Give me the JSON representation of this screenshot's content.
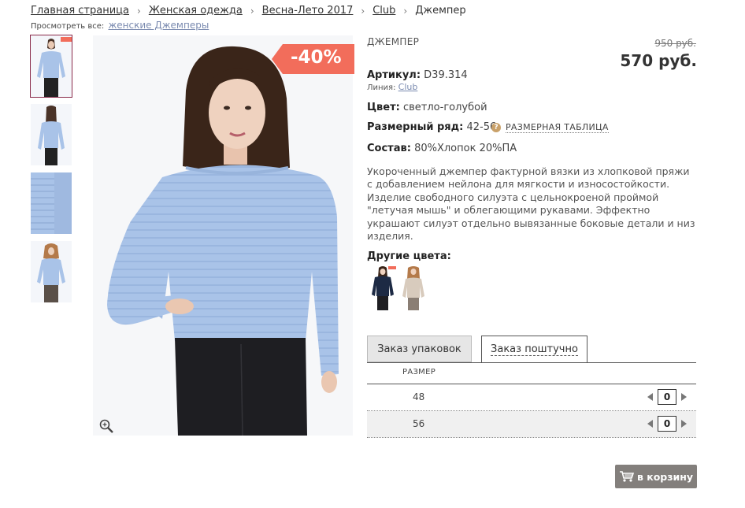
{
  "breadcrumb": {
    "items": [
      "Главная страница",
      "Женская одежда",
      "Весна-Лето 2017",
      "Club"
    ],
    "current": "Джемпер",
    "separator": "›"
  },
  "view_all": {
    "label": "Просмотреть все:",
    "link": "женские Джемперы"
  },
  "badge": {
    "discount": "-40%",
    "color": "#f26d5b"
  },
  "product": {
    "type": "ДЖЕМПЕР",
    "old_price": "950 руб.",
    "price": "570 руб.",
    "article_label": "Артикул:",
    "article": "D39.314",
    "line_label": "Линия:",
    "line": "Club",
    "color_label": "Цвет:",
    "color": "светло-голубой",
    "size_range_label": "Размерный ряд:",
    "size_range": "42-56",
    "size_chart": "РАЗМЕРНАЯ ТАБЛИЦА",
    "composition_label": "Состав:",
    "composition": "80%Хлопок 20%ПА",
    "description": "Укороченный джемпер фактурной вязки из хлопковой пряжи с добавлением нейлона для мягкости и износостойкости. Изделие свободного силуэта с цельнокроеной проймой \"летучая мышь\" и облегающими рукавами. Эффектно украшают силуэт отдельно вывязанные боковые детали и низ изделия."
  },
  "other_colors": {
    "label": "Другие цвета:"
  },
  "tabs": {
    "packs": "Заказ упаковок",
    "single": "Заказ поштучно"
  },
  "size_table": {
    "header": "РАЗМЕР",
    "rows": [
      {
        "size": "48",
        "qty": "0"
      },
      {
        "size": "56",
        "qty": "0"
      }
    ]
  },
  "cart": {
    "label": "в корзину"
  },
  "colors": {
    "sweater": "#a9c3e8",
    "accent": "#8a2a4a",
    "button": "#837f7c",
    "link": "#7b8bb0"
  }
}
